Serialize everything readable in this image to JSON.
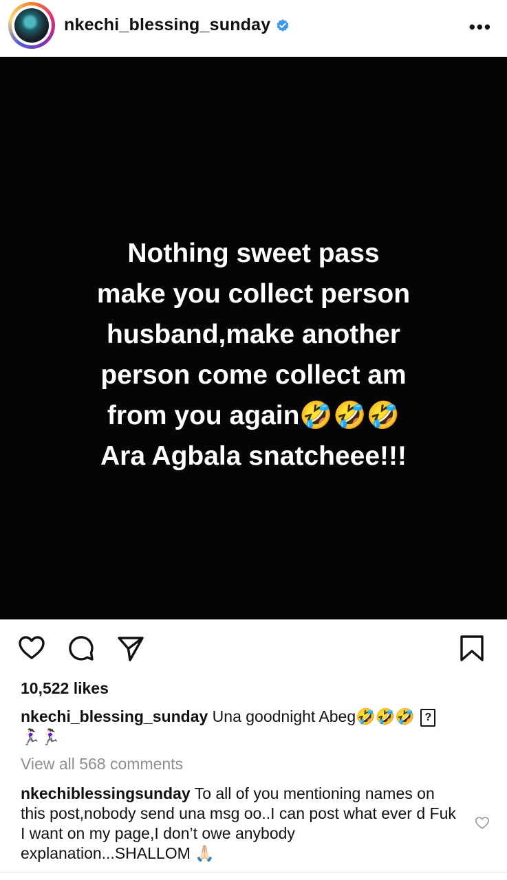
{
  "header": {
    "username": "nkechi_blessing_sunday",
    "more_label": "•••"
  },
  "post": {
    "lines": [
      "Nothing sweet pass",
      "make you collect person",
      "husband,make another",
      "person come collect am",
      "from you again🤣🤣🤣",
      "Ara Agbala snatcheee!!!"
    ]
  },
  "engagement": {
    "likes": "10,522 likes"
  },
  "caption": {
    "username": "nkechi_blessing_sunday",
    "text": "Una goodnight Abeg🤣🤣🤣",
    "unknown_glyph": "?",
    "runner_emojis": "🏃🏻‍♀️🏃🏻‍♀️"
  },
  "comments": {
    "view_all": "View all 568 comments",
    "top": {
      "username": "nkechiblessingsunday",
      "text": "To all of you mentioning names on this post,nobody send una msg oo..I can post what ever d Fuk I want on my page,I don’t owe anybody explanation...SHALLOM 🙏🏻"
    }
  },
  "icons": {
    "like": "heart-icon",
    "comment": "comment-icon",
    "share": "send-icon",
    "save": "bookmark-icon",
    "verified": "verified-badge-icon",
    "comment_like": "small-heart-icon"
  },
  "colors": {
    "verified_blue": "#3897f0",
    "post_background": "#050505",
    "muted_text": "#8e8e8e"
  }
}
